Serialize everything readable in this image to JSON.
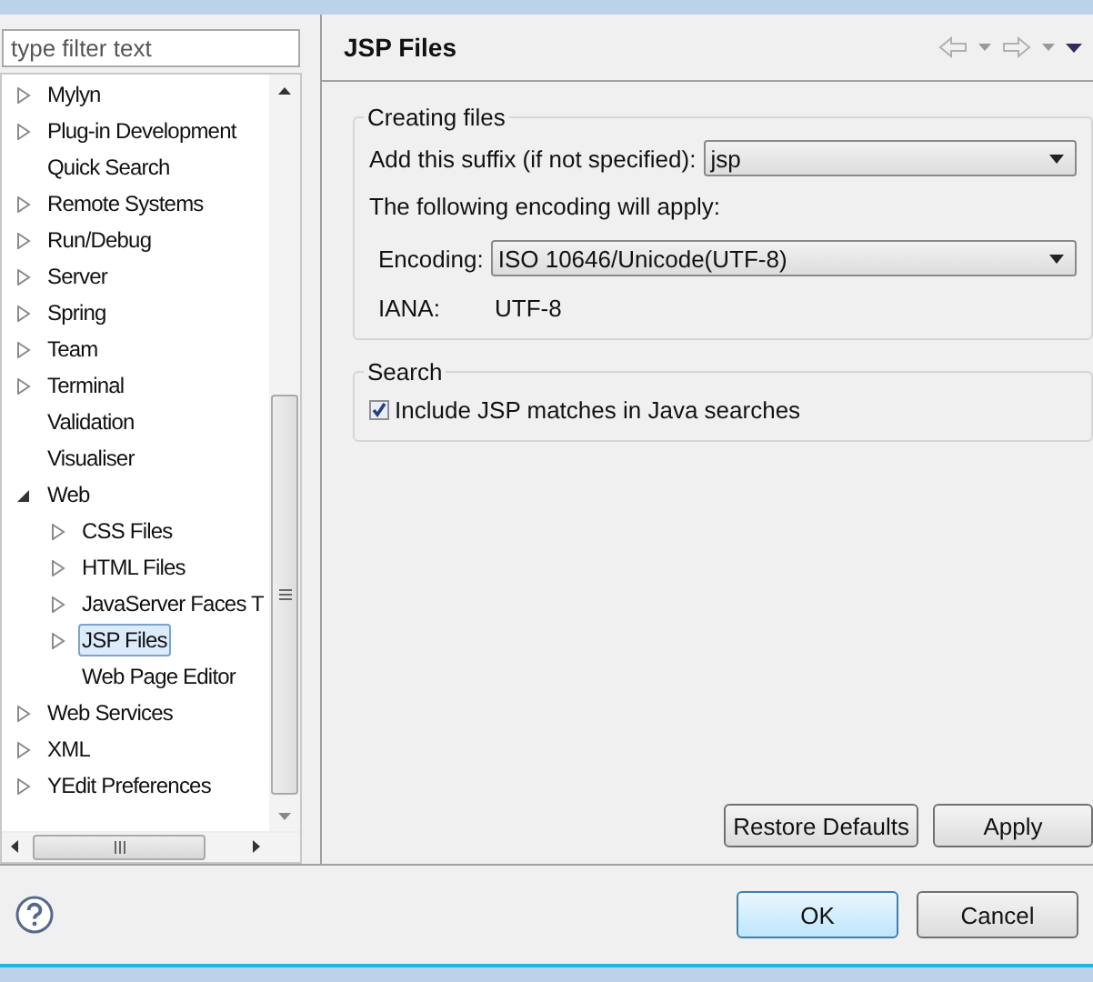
{
  "filter": {
    "placeholder": "type filter text"
  },
  "tree": [
    {
      "label": "Mylyn",
      "expanded": false,
      "selected": false
    },
    {
      "label": "Plug-in Development",
      "expanded": false,
      "selected": false
    },
    {
      "label": "Quick Search",
      "selected": false
    },
    {
      "label": "Remote Systems",
      "expanded": false,
      "selected": false
    },
    {
      "label": "Run/Debug",
      "expanded": false,
      "selected": false
    },
    {
      "label": "Server",
      "expanded": false,
      "selected": false
    },
    {
      "label": "Spring",
      "expanded": false,
      "selected": false
    },
    {
      "label": "Team",
      "expanded": false,
      "selected": false
    },
    {
      "label": "Terminal",
      "expanded": false,
      "selected": false
    },
    {
      "label": "Validation",
      "selected": false
    },
    {
      "label": "Visualiser",
      "selected": false
    },
    {
      "label": "Web",
      "expanded": true,
      "selected": false,
      "children": [
        {
          "label": "CSS Files",
          "expanded": false,
          "selected": false
        },
        {
          "label": "HTML Files",
          "expanded": false,
          "selected": false
        },
        {
          "label": "JavaServer Faces T",
          "expanded": false,
          "selected": false
        },
        {
          "label": "JSP Files",
          "expanded": false,
          "selected": true
        },
        {
          "label": "Web Page Editor",
          "selected": false
        }
      ]
    },
    {
      "label": "Web Services",
      "expanded": false,
      "selected": false
    },
    {
      "label": "XML",
      "expanded": false,
      "selected": false
    },
    {
      "label": "YEdit Preferences",
      "expanded": false,
      "selected": false
    }
  ],
  "page": {
    "title": "JSP Files",
    "creating_files": {
      "title": "Creating files",
      "suffix_label": "Add this suffix (if not specified):",
      "suffix_value": "jsp",
      "encoding_note": "The following encoding will apply:",
      "encoding_label": "Encoding:",
      "encoding_value": "ISO 10646/Unicode(UTF-8)",
      "iana_label": "IANA:",
      "iana_value": "UTF-8"
    },
    "search": {
      "title": "Search",
      "option": {
        "label": "Include JSP matches in Java searches",
        "checked": true
      }
    },
    "buttons": [
      "Restore Defaults",
      "Apply"
    ]
  },
  "footer": {
    "buttons": [
      {
        "label": "OK",
        "default": true
      },
      {
        "label": "Cancel",
        "default": false
      }
    ]
  }
}
